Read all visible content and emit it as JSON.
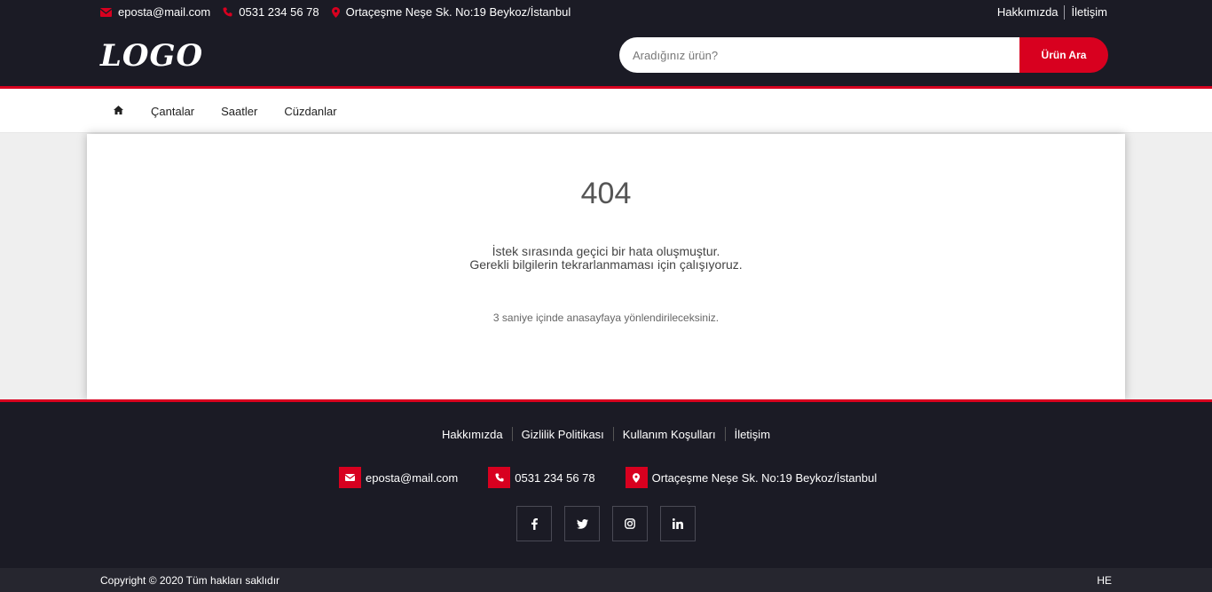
{
  "topbar": {
    "email": "eposta@mail.com",
    "phone": "0531 234 56 78",
    "address": "Ortaçeşme Neşe Sk. No:19 Beykoz/İstanbul",
    "links": [
      "Hakkımızda",
      "İletişim"
    ]
  },
  "header": {
    "logo": "LOGO",
    "search_placeholder": "Aradığınız ürün?",
    "search_button": "Ürün Ara"
  },
  "nav": {
    "items": [
      "Çantalar",
      "Saatler",
      "Cüzdanlar"
    ]
  },
  "error": {
    "code": "404",
    "line1": "İstek sırasında geçici bir hata oluşmuştur.",
    "line2": "Gerekli bilgilerin tekrarlanmaması için çalışıyoruz.",
    "redirect": "3 saniye içinde anasayfaya yönlendirileceksiniz."
  },
  "footer": {
    "links": [
      "Hakkımızda",
      "Gizlilik Politikası",
      "Kullanım Koşulları",
      "İletişim"
    ],
    "email": "eposta@mail.com",
    "phone": "0531 234 56 78",
    "address": "Ortaçeşme Neşe Sk. No:19 Beykoz/İstanbul",
    "social": [
      "facebook-icon",
      "twitter-icon",
      "instagram-icon",
      "linkedin-icon"
    ],
    "copyright": "Copyright © 2020 Tüm hakları saklıdır",
    "badge": "HE"
  },
  "colors": {
    "accent": "#d8001f",
    "dark": "#1b1b25",
    "bottom": "#26262f"
  }
}
